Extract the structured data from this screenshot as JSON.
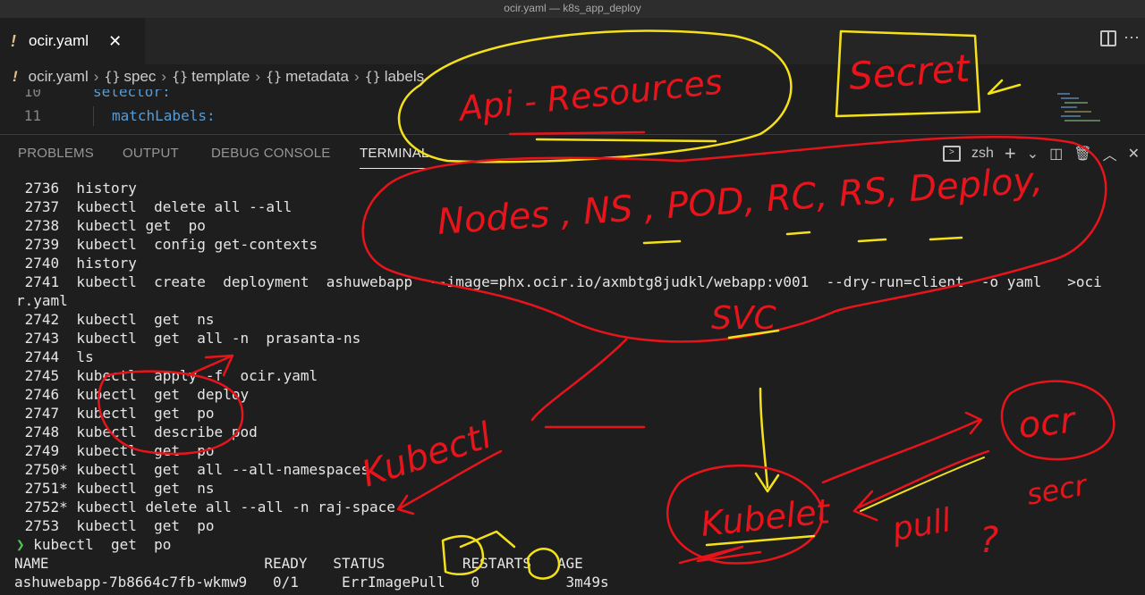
{
  "window": {
    "title": "ocir.yaml — k8s_app_deploy"
  },
  "tab": {
    "icon": "!",
    "name": "ocir.yaml",
    "close": "✕"
  },
  "breadcrumb": {
    "file": "ocir.yaml",
    "items": [
      "spec",
      "template",
      "metadata",
      "labels"
    ],
    "symbol": "{}"
  },
  "editor": {
    "lines": [
      {
        "num": "10",
        "text": "selector:"
      },
      {
        "num": "11",
        "text": "matchLabels:"
      }
    ]
  },
  "panel": {
    "tabs": [
      "PROBLEMS",
      "OUTPUT",
      "DEBUG CONSOLE",
      "TERMINAL"
    ],
    "active_tab": "TERMINAL",
    "shell": "zsh",
    "add_icon": "+",
    "chevron": "⌄"
  },
  "terminal": {
    "lines": [
      " 2736  history",
      " 2737  kubectl  delete all --all",
      " 2738  kubectl get  po",
      " 2739  kubectl  config get-contexts",
      " 2740  history",
      " 2741  kubectl  create  deployment  ashuwebapp  --image=phx.ocir.io/axmbtg8judkl/webapp:v001  --dry-run=client  -o yaml   >oci",
      "r.yaml",
      " 2742  kubectl  get  ns",
      " 2743  kubectl  get  all -n  prasanta-ns",
      " 2744  ls",
      " 2745  kubectl  apply -f  ocir.yaml",
      " 2746  kubectl  get  deploy",
      " 2747  kubectl  get  po",
      " 2748  kubectl  describe pod",
      " 2749  kubectl  get  po",
      " 2750* kubectl  get  all --all-namespaces",
      " 2751* kubectl  get  ns",
      " 2752* kubectl delete all --all -n raj-space",
      " 2753  kubectl  get  po"
    ],
    "prompt_symbol": "❯",
    "current_command": " kubectl  get  po",
    "output_header": "NAME                         READY   STATUS         RESTARTS   AGE",
    "output_row": "ashuwebapp-7b8664c7fb-wkmw9   0/1     ErrImagePull   0          3m49s"
  },
  "annotations": {
    "api_resources": "Api - Resources",
    "secret": "Secret",
    "nodes_list": "Nodes , NS , POD, RC, RS, Deploy,",
    "svc": "SVC",
    "kubectl": "Kubectl",
    "kubelet": "Kubelet",
    "ocr": "ocr",
    "pull": "pull",
    "secr": "secr",
    "question": "?",
    "colors": {
      "red": "#e8141b",
      "yellow": "#f5e11a"
    }
  }
}
